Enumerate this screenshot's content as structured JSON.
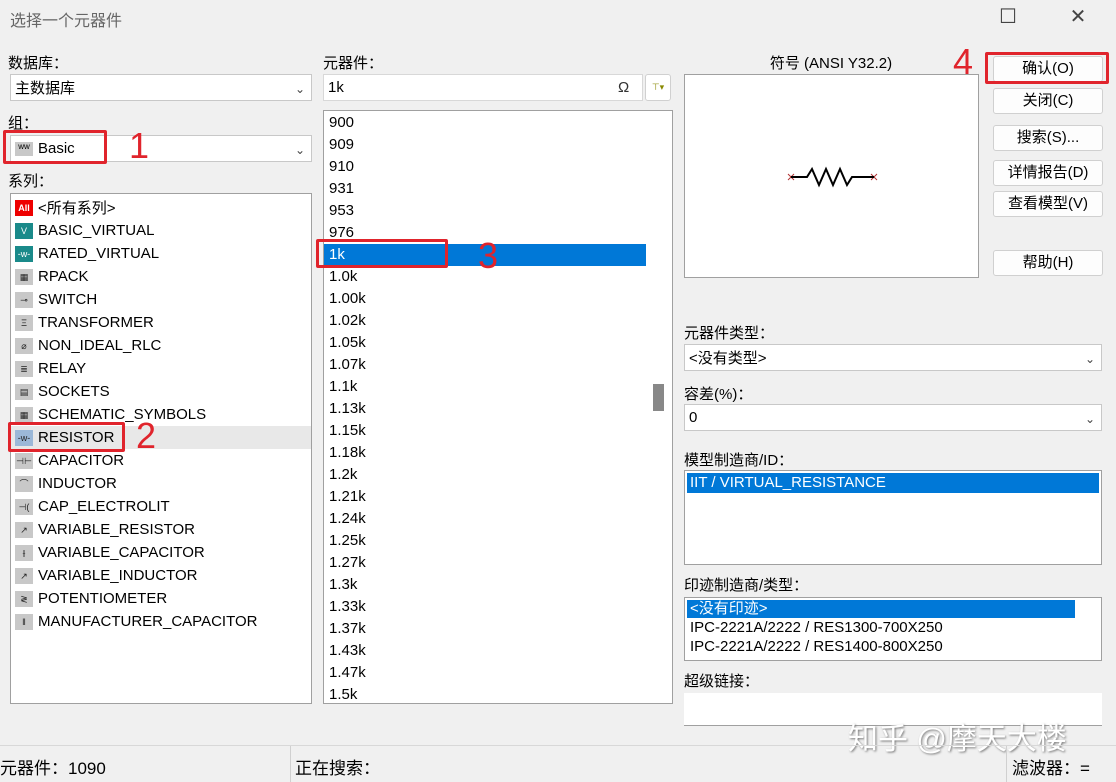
{
  "window": {
    "title": "选择一个元器件",
    "minimize": "☐",
    "close": "✕"
  },
  "database": {
    "label": "数据库：",
    "value": "主数据库"
  },
  "group": {
    "label": "组：",
    "value": "Basic",
    "icon_text": "ww"
  },
  "series": {
    "label": "系列：",
    "items": [
      {
        "label": "<所有系列>",
        "icon": "All"
      },
      {
        "label": "BASIC_VIRTUAL",
        "icon": "V"
      },
      {
        "label": "RATED_VIRTUAL",
        "icon": "-w-"
      },
      {
        "label": "RPACK",
        "icon": "▦"
      },
      {
        "label": "SWITCH",
        "icon": "⊸"
      },
      {
        "label": "TRANSFORMER",
        "icon": "Ξ"
      },
      {
        "label": "NON_IDEAL_RLC",
        "icon": "⌀"
      },
      {
        "label": "RELAY",
        "icon": "≣"
      },
      {
        "label": "SOCKETS",
        "icon": "▤"
      },
      {
        "label": "SCHEMATIC_SYMBOLS",
        "icon": "▦"
      },
      {
        "label": "RESISTOR",
        "icon": "-w-"
      },
      {
        "label": "CAPACITOR",
        "icon": "⊣⊢"
      },
      {
        "label": "INDUCTOR",
        "icon": "⌒"
      },
      {
        "label": "CAP_ELECTROLIT",
        "icon": "⊣("
      },
      {
        "label": "VARIABLE_RESISTOR",
        "icon": "↗"
      },
      {
        "label": "VARIABLE_CAPACITOR",
        "icon": "⫲"
      },
      {
        "label": "VARIABLE_INDUCTOR",
        "icon": "↗"
      },
      {
        "label": "POTENTIOMETER",
        "icon": "≷"
      },
      {
        "label": "MANUFACTURER_CAPACITOR",
        "icon": "‖"
      }
    ]
  },
  "component": {
    "label": "元器件：",
    "value": "1k",
    "omega": "Ω",
    "filter_icon": "⊤▾",
    "items": [
      "900",
      "909",
      "910",
      "931",
      "953",
      "976",
      "1k",
      "1.0k",
      "1.00k",
      "1.02k",
      "1.05k",
      "1.07k",
      "1.1k",
      "1.13k",
      "1.15k",
      "1.18k",
      "1.2k",
      "1.21k",
      "1.24k",
      "1.25k",
      "1.27k",
      "1.3k",
      "1.33k",
      "1.37k",
      "1.43k",
      "1.47k",
      "1.5k"
    ],
    "selected_index": 6
  },
  "symbol": {
    "label": "符号 (ANSI Y32.2)"
  },
  "buttons": {
    "ok": "确认(O)",
    "close": "关闭(C)",
    "search": "搜索(S)...",
    "detail": "详情报告(D)",
    "model": "查看模型(V)",
    "help": "帮助(H)"
  },
  "component_type": {
    "label": "元器件类型：",
    "value": "<没有类型>"
  },
  "tolerance": {
    "label": "容差(%)：",
    "value": "0"
  },
  "model_mfr": {
    "label": "模型制造商/ID：",
    "items": [
      "IIT / VIRTUAL_RESISTANCE"
    ]
  },
  "footprint": {
    "label": "印迹制造商/类型：",
    "items": [
      "<没有印迹>",
      "IPC-2221A/2222 / RES1300-700X250",
      "IPC-2221A/2222 / RES1400-800X250"
    ]
  },
  "hyperlink": {
    "label": "超级链接：",
    "value": ""
  },
  "status": {
    "count": "元器件：1090",
    "searching": "正在搜索：",
    "filter": "滤波器：="
  },
  "annotations": [
    "1",
    "2",
    "3",
    "4"
  ],
  "watermark": "知乎 @摩天大楼"
}
